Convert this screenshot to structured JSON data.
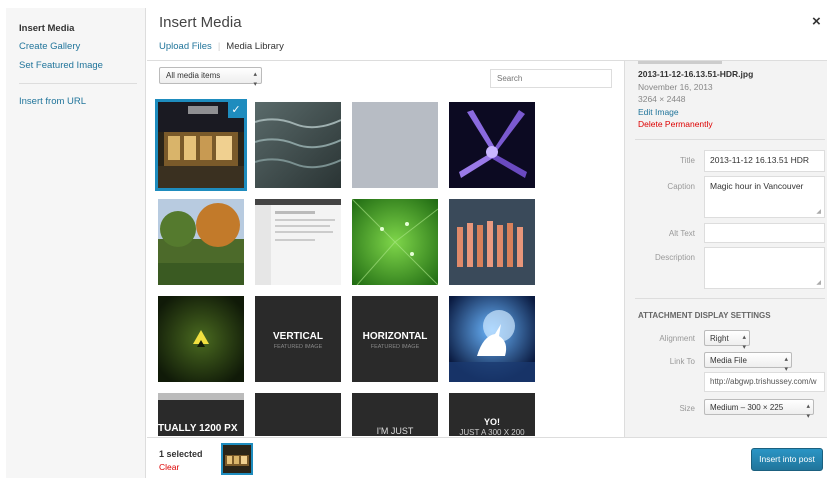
{
  "menu": {
    "items": [
      {
        "label": "Insert Media"
      },
      {
        "label": "Create Gallery"
      },
      {
        "label": "Set Featured Image"
      },
      {
        "label": "Insert from URL"
      }
    ]
  },
  "header": {
    "title": "Insert Media",
    "close": "×",
    "tabs": [
      {
        "label": "Upload Files"
      },
      {
        "label": "Media Library"
      }
    ]
  },
  "toolbar": {
    "filter_value": "All media items",
    "search_placeholder": "Search"
  },
  "grid": {
    "tiles": [
      {
        "caption": "",
        "sub": ""
      },
      {
        "caption": "",
        "sub": ""
      },
      {
        "caption": "",
        "sub": ""
      },
      {
        "caption": "",
        "sub": ""
      },
      {
        "caption": "",
        "sub": ""
      },
      {
        "caption": "",
        "sub": ""
      },
      {
        "caption": "",
        "sub": ""
      },
      {
        "caption": "",
        "sub": ""
      },
      {
        "caption": "",
        "sub": ""
      },
      {
        "caption": "VERTICAL",
        "sub": "FEATURED IMAGE"
      },
      {
        "caption": "HORIZONTAL",
        "sub": "FEATURED IMAGE"
      },
      {
        "caption": "",
        "sub": ""
      },
      {
        "caption": "TUALLY 1200 PX",
        "sub": ""
      },
      {
        "caption": "",
        "sub": ""
      },
      {
        "caption": "I'M JUST",
        "sub": ""
      },
      {
        "caption": "YO!",
        "sub": "JUST A 300 X 200"
      }
    ]
  },
  "details": {
    "filename": "2013-11-12-16.13.51-HDR.jpg",
    "date": "November 16, 2013",
    "dimensions": "3264 × 2448",
    "edit_link": "Edit Image",
    "delete_link": "Delete Permanently",
    "fields": {
      "title_label": "Title",
      "title_value": "2013-11-12 16.13.51 HDR",
      "caption_label": "Caption",
      "caption_value": "Magic hour in Vancouver",
      "alt_label": "Alt Text",
      "alt_value": "",
      "description_label": "Description",
      "description_value": ""
    }
  },
  "display_settings": {
    "heading": "ATTACHMENT DISPLAY SETTINGS",
    "alignment_label": "Alignment",
    "alignment_value": "Right",
    "link_label": "Link To",
    "link_value": "Media File",
    "url_value": "http://abgwp.trishussey.com/w",
    "size_label": "Size",
    "size_value": "Medium – 300 × 225"
  },
  "footer": {
    "selected_count": "1 selected",
    "clear": "Clear",
    "insert_button": "Insert into post"
  },
  "colors": {
    "accent": "#21759b",
    "selection": "#1e8cbe",
    "danger": "#dd0000"
  }
}
